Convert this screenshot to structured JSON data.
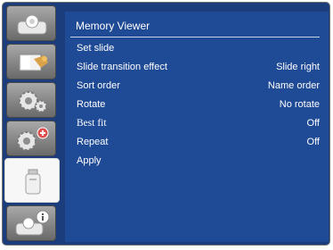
{
  "menu_title": "Memory Viewer",
  "items": [
    {
      "label": "Set slide",
      "value": ""
    },
    {
      "label": "Slide transition effect",
      "value": "Slide right"
    },
    {
      "label": "Sort order",
      "value": "Name order"
    },
    {
      "label": "Rotate",
      "value": "No rotate"
    },
    {
      "label": "Best  fit",
      "value": "Off"
    },
    {
      "label": "Repeat",
      "value": "Off"
    },
    {
      "label": "Apply",
      "value": ""
    }
  ],
  "sidebar_tabs": [
    {
      "icon": "display-icon",
      "active": false
    },
    {
      "icon": "picture-adjust-icon",
      "active": false
    },
    {
      "icon": "settings-gear-icon",
      "active": false
    },
    {
      "icon": "advanced-settings-gear-icon",
      "active": false
    },
    {
      "icon": "usb-memory-icon",
      "active": true
    },
    {
      "icon": "information-icon",
      "active": false
    }
  ],
  "colors": {
    "frame": "#1c3d7c",
    "panel": "#1f4a96",
    "text": "#ffffff"
  }
}
